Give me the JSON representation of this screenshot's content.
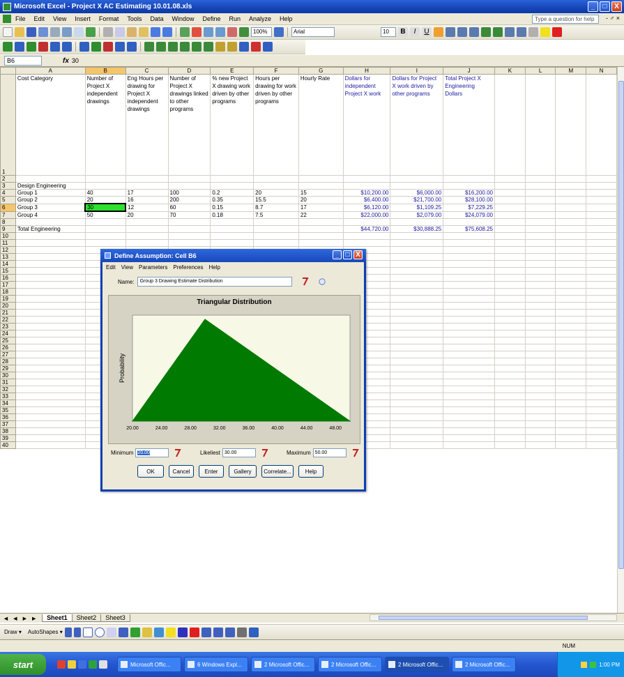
{
  "window": {
    "title": "Microsoft Excel - Project X AC Estimating 10.01.08.xls",
    "buttons": [
      "_",
      "□",
      "X"
    ]
  },
  "menu": {
    "items": [
      "File",
      "Edit",
      "View",
      "Insert",
      "Format",
      "Tools",
      "Data",
      "Window",
      "Define",
      "Run",
      "Analyze",
      "Help"
    ],
    "help_placeholder": "Type a question for help",
    "right_controls": "- ♂ ×"
  },
  "toolbar": {
    "zoom": "100%",
    "font": "Arial",
    "font_size": "10"
  },
  "formula_bar": {
    "name_box": "B6",
    "fx": "fx",
    "value": "30"
  },
  "grid": {
    "columns": [
      "A",
      "B",
      "C",
      "D",
      "E",
      "F",
      "G",
      "H",
      "I",
      "J",
      "K",
      "L",
      "M",
      "N"
    ],
    "selected_column": "B",
    "selected_row": "6",
    "header_row": {
      "A": "Cost Category",
      "B": "Number of Project X independent drawings",
      "C": "Eng Hours per drawing for Project X independent drawings",
      "D": "Number of Project X drawings linked to other programs",
      "E": "% new Project X drawing work driven by other programs",
      "F": "Hours per drawing for work driven by other programs",
      "G": "Hourly Rate",
      "H": "Dollars for independent Project X work",
      "I": "Dollars for Project X work driven by other programs",
      "J": "Total Project X Engineering Dollars"
    },
    "row3_label": "Design Engineering",
    "groups": [
      {
        "row": "4",
        "name": "Group 1",
        "b": "40",
        "c": "17",
        "d": "100",
        "e": "0.2",
        "f": "20",
        "g": "15",
        "h": "$10,200.00",
        "i": "$6,000.00",
        "j": "$16,200.00"
      },
      {
        "row": "5",
        "name": "Group 2",
        "b": "20",
        "c": "16",
        "d": "200",
        "e": "0.35",
        "f": "15.5",
        "g": "20",
        "h": "$6,400.00",
        "i": "$21,700.00",
        "j": "$28,100.00"
      },
      {
        "row": "6",
        "name": "Group 3",
        "b": "30",
        "c": "12",
        "d": "60",
        "e": "0.15",
        "f": "8.7",
        "g": "17",
        "h": "$6,120.00",
        "i": "$1,109.25",
        "j": "$7,229.25"
      },
      {
        "row": "7",
        "name": "Group 4",
        "b": "50",
        "c": "20",
        "d": "70",
        "e": "0.18",
        "f": "7.5",
        "g": "22",
        "h": "$22,000.00",
        "i": "$2,079.00",
        "j": "$24,079.00"
      }
    ],
    "total": {
      "row": "9",
      "name": "Total Engineering",
      "h": "$44,720.00",
      "i": "$30,888.25",
      "j": "$75,608.25"
    },
    "row_numbers": [
      "1",
      "2",
      "3",
      "4",
      "5",
      "6",
      "7",
      "8",
      "9",
      "10",
      "11",
      "12",
      "13",
      "14",
      "15",
      "16",
      "17",
      "18",
      "19",
      "20",
      "21",
      "22",
      "23",
      "24",
      "25",
      "26",
      "27",
      "28",
      "29",
      "30",
      "31",
      "32",
      "33",
      "34",
      "35",
      "36",
      "37",
      "38",
      "39",
      "40"
    ]
  },
  "sheet_tabs": {
    "nav": "◄ ◄ ► ►",
    "tabs": [
      "Sheet1",
      "Sheet2",
      "Sheet3"
    ],
    "active": "Sheet1"
  },
  "drawbar": {
    "draw_label": "Draw ▾",
    "autoshapes_label": "AutoShapes ▾"
  },
  "status": {
    "num": "NUM"
  },
  "taskbar": {
    "start": "start",
    "items": [
      "Microsoft Offic...",
      "6 Windows Expl...",
      "2 Microsoft Offic...",
      "2 Microsoft Offic...",
      "2 Microsoft Offic...",
      "2 Microsoft Offic..."
    ],
    "active_index": 4,
    "clock": "1:00 PM"
  },
  "dialog": {
    "title": "Define Assumption: Cell B6",
    "menu": [
      "Edit",
      "View",
      "Parameters",
      "Preferences",
      "Help"
    ],
    "name_label": "Name:",
    "name_value": "Group 3 Drawing Estimate Distribution",
    "params": {
      "min_label": "Minimum",
      "min_value": "20.00",
      "likely_label": "Likeliest",
      "likely_value": "30.00",
      "max_label": "Maximum",
      "max_value": "50.00"
    },
    "buttons": [
      "OK",
      "Cancel",
      "Enter",
      "Gallery",
      "Correlate...",
      "Help"
    ]
  },
  "chart_data": {
    "type": "area",
    "title": "Triangular Distribution",
    "ylabel": "Probability",
    "xlabel": "",
    "x_ticks": [
      "20.00",
      "24.00",
      "28.00",
      "32.00",
      "36.00",
      "40.00",
      "44.00",
      "48.00"
    ],
    "xlim": [
      20,
      50
    ],
    "x": [
      20,
      30,
      50
    ],
    "y": [
      0,
      1,
      0
    ],
    "fill_color": "#007a00",
    "plot_background": "#f8f8e6"
  }
}
